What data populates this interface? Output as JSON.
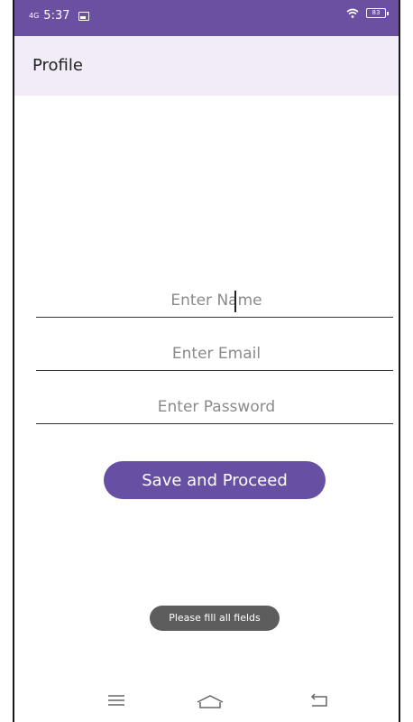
{
  "status_bar": {
    "network": "4G",
    "time": "5:37",
    "battery": "83"
  },
  "app_bar": {
    "title": "Profile"
  },
  "form": {
    "name_placeholder": "Enter Name",
    "email_placeholder": "Enter Email",
    "password_placeholder": "Enter Password",
    "submit_label": "Save and Proceed"
  },
  "toast": {
    "message": "Please fill all fields"
  },
  "nav_bar": {
    "icons": [
      "menu-icon",
      "home-icon",
      "back-icon"
    ]
  },
  "colors": {
    "primary": "#6750a4",
    "status_bar": "#6b4fa0",
    "app_bar_bg": "#f1ecf7",
    "toast_bg": "#5d5d5d"
  }
}
